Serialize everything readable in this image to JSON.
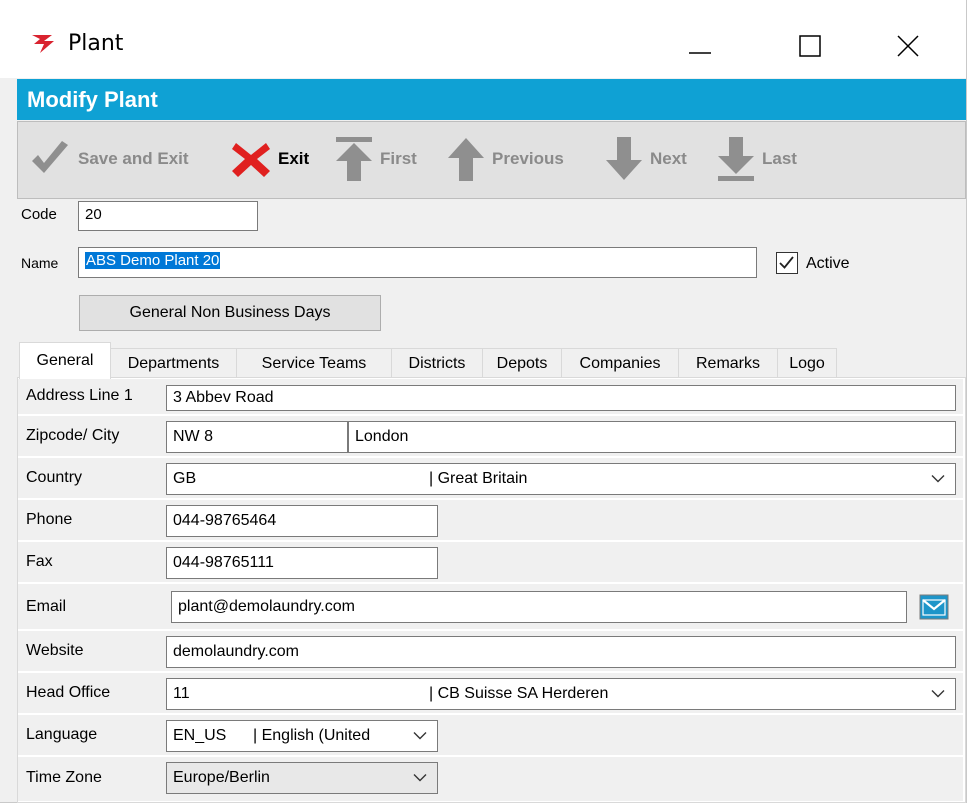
{
  "window": {
    "title": "Plant",
    "brand_color": "#d9232f"
  },
  "header": {
    "title": "Modify Plant",
    "color": "#0fa1d4"
  },
  "toolbar": {
    "save_and_exit": "Save and Exit",
    "exit": "Exit",
    "first": "First",
    "previous": "Previous",
    "next": "Next",
    "last": "Last"
  },
  "form": {
    "code_label": "Code",
    "code_value": "20",
    "name_label": "Name",
    "name_value": "ABS Demo Plant 20",
    "active_label": "Active",
    "active_checked": true,
    "general_non_business_days": "General Non Business Days"
  },
  "tabs": [
    {
      "label": "General",
      "active": true
    },
    {
      "label": "Departments"
    },
    {
      "label": "Service Teams"
    },
    {
      "label": "Districts"
    },
    {
      "label": "Depots"
    },
    {
      "label": "Companies"
    },
    {
      "label": "Remarks"
    },
    {
      "label": "Logo"
    }
  ],
  "general": {
    "address_line1_label": "Address Line 1",
    "address_line1_value": "3 Abbev Road",
    "zipcode_city_label": "Zipcode/ City",
    "zipcode_value": "NW 8",
    "city_value": "London",
    "country_label": "Country",
    "country_code": "GB",
    "country_name": "| Great Britain",
    "phone_label": "Phone",
    "phone_value": "044-98765464",
    "fax_label": "Fax",
    "fax_value": "044-98765111",
    "email_label": "Email",
    "email_value": "plant@demolaundry.com",
    "website_label": "Website",
    "website_value": "demolaundry.com",
    "head_office_label": "Head Office",
    "head_office_code": "11",
    "head_office_name": "| CB Suisse SA Herderen",
    "language_label": "Language",
    "language_code": "EN_US",
    "language_name": "| English (United",
    "time_zone_label": "Time Zone",
    "time_zone_value": "Europe/Berlin"
  }
}
